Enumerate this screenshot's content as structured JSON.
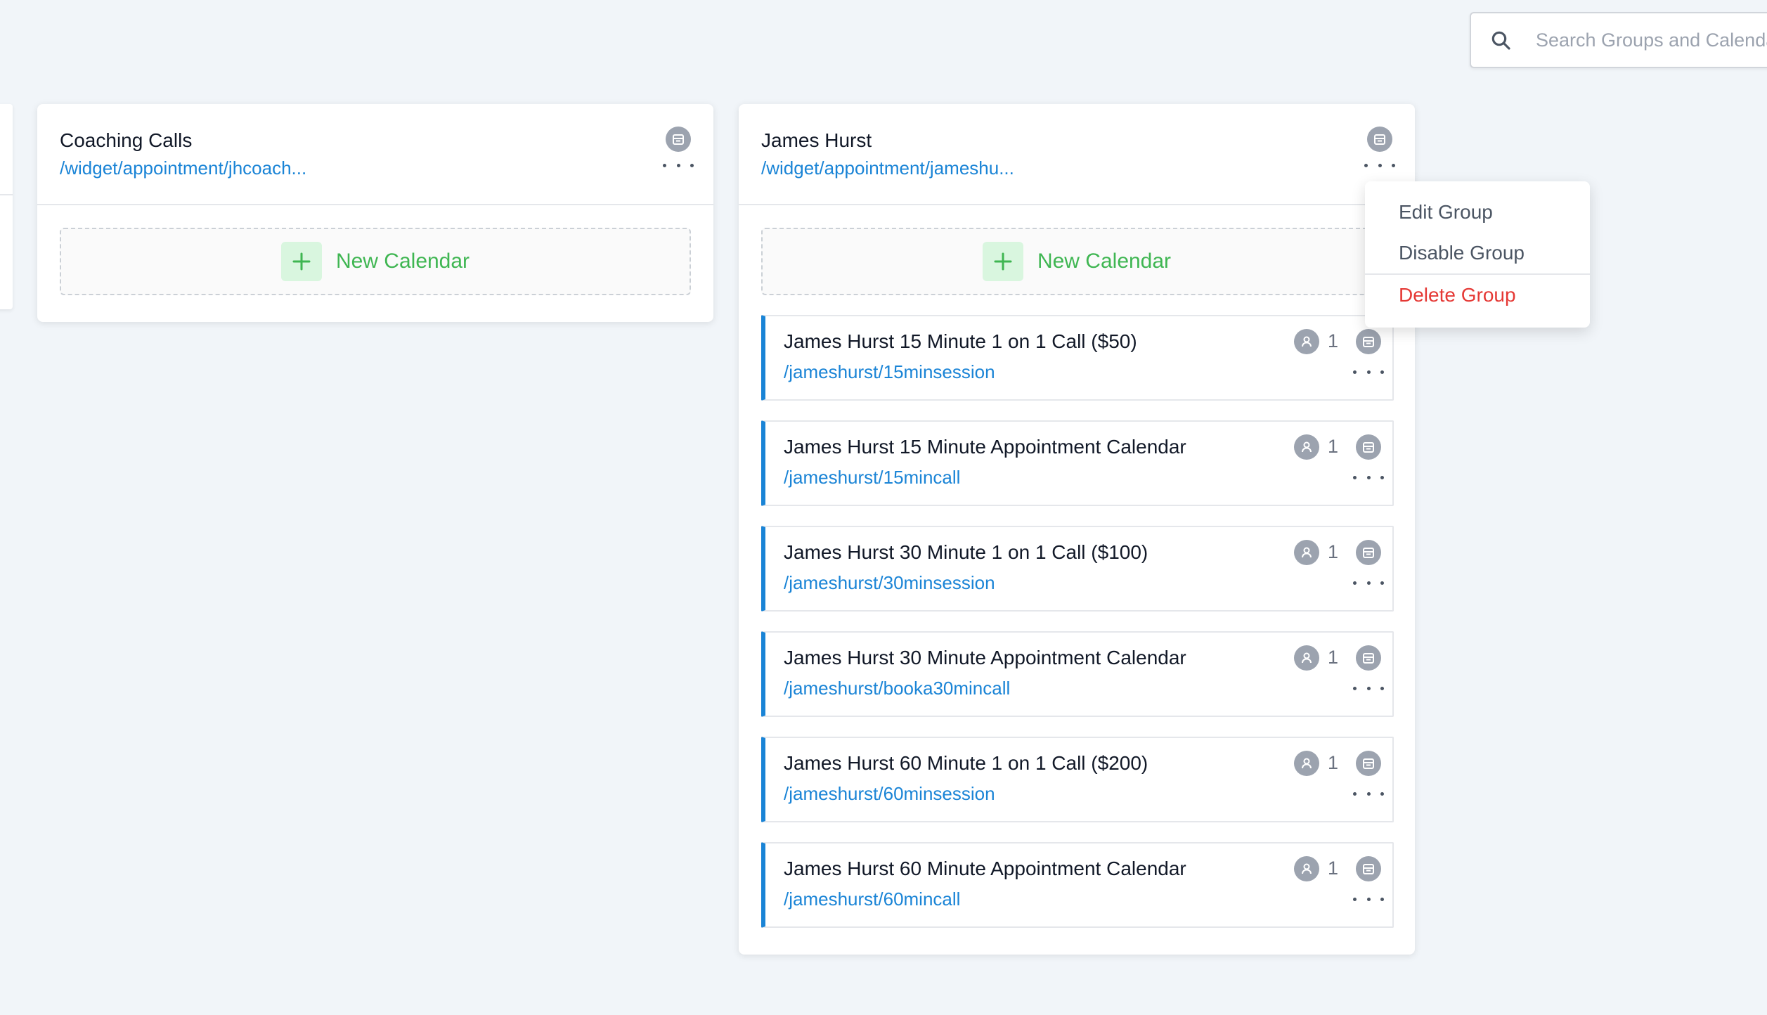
{
  "search": {
    "placeholder": "Search Groups and Calendars"
  },
  "groups": [
    {
      "title": "Coaching Calls",
      "link": "/widget/appointment/jhcoach...",
      "new_calendar_label": "New Calendar",
      "calendars": []
    },
    {
      "title": "James Hurst",
      "link": "/widget/appointment/jameshu...",
      "new_calendar_label": "New Calendar",
      "calendars": [
        {
          "title": "James Hurst 15 Minute 1 on 1 Call ($50)",
          "slug": "/jameshurst/15minsession",
          "user_count": "1"
        },
        {
          "title": "James Hurst 15 Minute Appointment Calendar",
          "slug": "/jameshurst/15mincall",
          "user_count": "1"
        },
        {
          "title": "James Hurst 30 Minute 1 on 1 Call ($100)",
          "slug": "/jameshurst/30minsession",
          "user_count": "1"
        },
        {
          "title": "James Hurst 30 Minute Appointment Calendar",
          "slug": "/jameshurst/booka30mincall",
          "user_count": "1"
        },
        {
          "title": "James Hurst 60 Minute 1 on 1 Call ($200)",
          "slug": "/jameshurst/60minsession",
          "user_count": "1"
        },
        {
          "title": "James Hurst 60 Minute Appointment Calendar",
          "slug": "/jameshurst/60mincall",
          "user_count": "1"
        }
      ]
    }
  ],
  "group_menu": {
    "items": [
      {
        "label": "Edit Group"
      },
      {
        "label": "Disable Group"
      },
      {
        "label": "Delete Group"
      }
    ]
  },
  "colors": {
    "accent": "#1a84d6",
    "success": "#3fb652",
    "danger": "#e53935",
    "background": "#f1f5f9"
  },
  "icons": {
    "search": "search-icon",
    "calendar": "calendar-icon",
    "more": "more-dots-icon",
    "plus": "plus-icon",
    "user": "user-icon"
  }
}
